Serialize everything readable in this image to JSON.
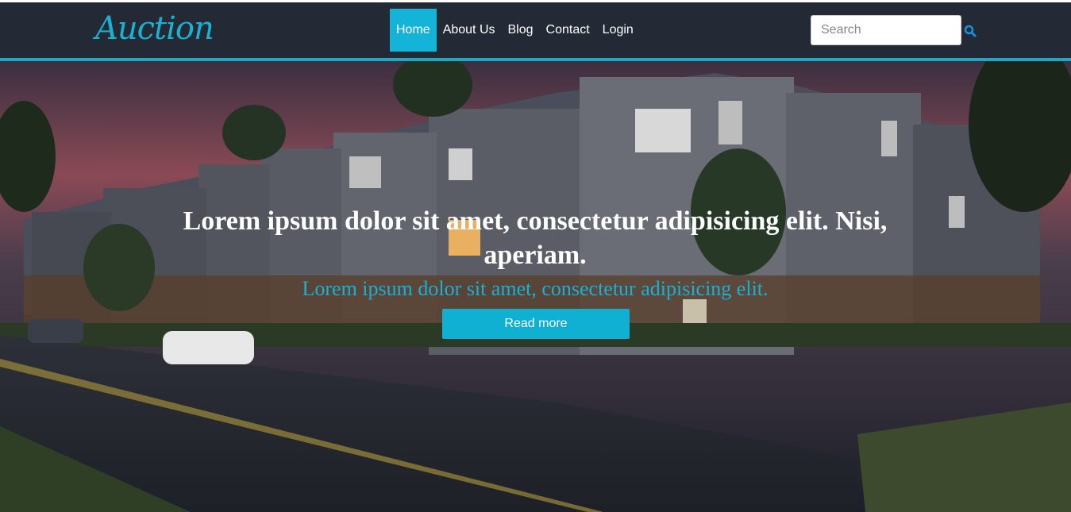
{
  "brand": {
    "logo_text": "Auction"
  },
  "nav": {
    "items": [
      {
        "label": "Home",
        "active": true
      },
      {
        "label": "About Us",
        "active": false
      },
      {
        "label": "Blog",
        "active": false
      },
      {
        "label": "Contact",
        "active": false
      },
      {
        "label": "Login",
        "active": false
      }
    ]
  },
  "search": {
    "placeholder": "Search",
    "value": ""
  },
  "hero": {
    "title": "Lorem ipsum dolor sit amet, consectetur adipisicing elit. Nisi, aperiam.",
    "subtitle": "Lorem ipsum dolor sit amet, consectetur adipisicing elit.",
    "button_label": "Read more"
  },
  "colors": {
    "navbar_bg": "#232a35",
    "accent": "#14b4d8",
    "logo": "#1ab0d0"
  }
}
